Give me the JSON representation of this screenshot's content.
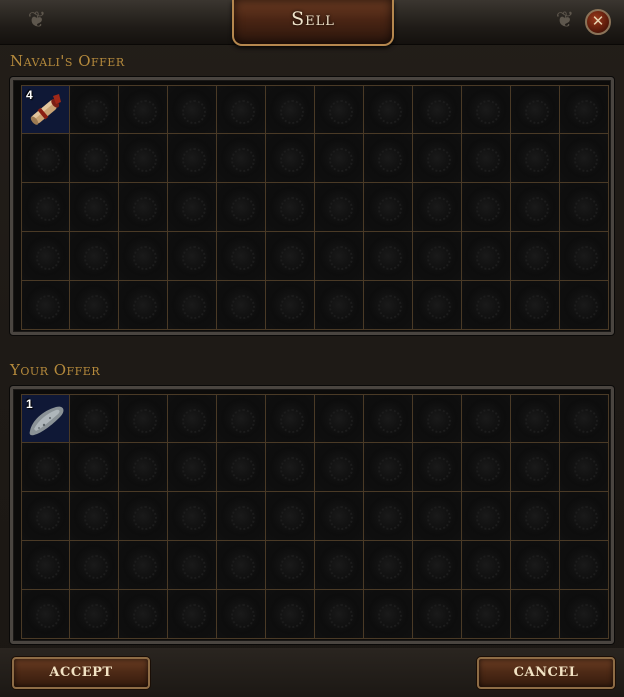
{
  "window": {
    "title": "Sell",
    "close_symbol": "✕"
  },
  "top": {
    "ornament_left_icon": "ornament-icon",
    "ornament_right_icon": "ornament-icon"
  },
  "navali_offer": {
    "label": "Navali's Offer",
    "grid": {
      "columns": 12,
      "rows": 5
    },
    "items": [
      {
        "icon": "scroll-icon",
        "count": "4",
        "row": 0,
        "col": 0
      }
    ]
  },
  "your_offer": {
    "label": "Your Offer",
    "grid": {
      "columns": 12,
      "rows": 5
    },
    "items": [
      {
        "icon": "whetstone-icon",
        "count": "1",
        "row": 0,
        "col": 0
      }
    ]
  },
  "buttons": {
    "accept": "ACCEPT",
    "cancel": "CANCEL"
  },
  "colors": {
    "label_gold": "#b58a3c",
    "item_cell_bg": "#0f1836",
    "button_brown": "#4e2a16"
  }
}
